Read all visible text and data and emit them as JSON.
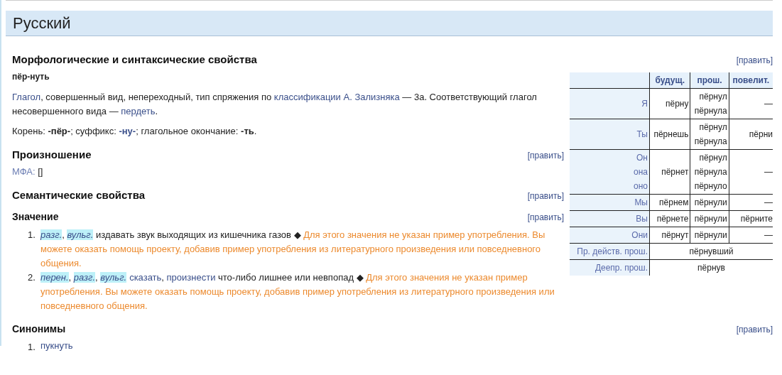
{
  "language_header": "Русский",
  "morphology": {
    "heading": "Морфологические и синтаксические свойства",
    "edit": "[править]",
    "headword": "пёр-нуть",
    "paragraphs": [
      [
        {
          "kind": "link",
          "text": "Глагол"
        },
        {
          "kind": "plain",
          "text": ", совершенный вид, непереходный, тип спряжения по "
        },
        {
          "kind": "link",
          "text": "классификации А. Зализняка"
        },
        {
          "kind": "plain",
          "text": " — 3a. Соответствующий глагол несовершенного вида — "
        },
        {
          "kind": "link",
          "text": "пердеть"
        },
        {
          "kind": "plain",
          "text": "."
        }
      ],
      [
        {
          "kind": "plain",
          "text": "Корень: "
        },
        {
          "kind": "bold",
          "text": "-пёр-"
        },
        {
          "kind": "plain",
          "text": "; суффикс: "
        },
        {
          "kind": "boldlink",
          "text": "-ну-"
        },
        {
          "kind": "plain",
          "text": "; глагольное окончание: "
        },
        {
          "kind": "bold",
          "text": "-ть"
        },
        {
          "kind": "plain",
          "text": "."
        }
      ]
    ]
  },
  "conjugation": {
    "columns": [
      "будущ.",
      "прош.",
      "повелит."
    ],
    "rows": [
      {
        "person": [
          "Я"
        ],
        "forms": [
          [
            "пёрну"
          ],
          [
            "пёрнул",
            "пёрнула"
          ],
          [
            "—"
          ]
        ]
      },
      {
        "person": [
          "Ты"
        ],
        "forms": [
          [
            "пёрнешь"
          ],
          [
            "пёрнул",
            "пёрнула"
          ],
          [
            "пёрни"
          ]
        ]
      },
      {
        "person": [
          "Он",
          "она",
          "оно"
        ],
        "forms": [
          [
            "пёрнет"
          ],
          [
            "пёрнул",
            "пёрнула",
            "пёрнуло"
          ],
          [
            "—"
          ]
        ]
      },
      {
        "person": [
          "Мы"
        ],
        "forms": [
          [
            "пёрнем"
          ],
          [
            "пёрнули"
          ],
          [
            "—"
          ]
        ]
      },
      {
        "person": [
          "Вы"
        ],
        "forms": [
          [
            "пёрнете"
          ],
          [
            "пёрнули"
          ],
          [
            "пёрните"
          ]
        ]
      },
      {
        "person": [
          "Они"
        ],
        "forms": [
          [
            "пёрнут"
          ],
          [
            "пёрнули"
          ],
          [
            "—"
          ]
        ]
      }
    ],
    "participles": [
      {
        "label": "Пр. действ. прош.",
        "value": "пёрнувший"
      },
      {
        "label": "Деепр. прош.",
        "value": "пёрнув"
      }
    ]
  },
  "pronunciation": {
    "heading": "Произношение",
    "edit": "[править]",
    "ipa_label": "МФА:",
    "ipa_value": "[]"
  },
  "semantics": {
    "heading": "Семантические свойства",
    "edit": "[править]"
  },
  "meaning": {
    "heading": "Значение",
    "edit": "[править]",
    "items": [
      {
        "number": "1.",
        "segments": [
          {
            "kind": "tag",
            "text": "разг."
          },
          {
            "kind": "plain",
            "text": ", "
          },
          {
            "kind": "tag",
            "text": "вульг."
          },
          {
            "kind": "plain",
            "text": " издавать звук выходящих из кишечника газов ◆ "
          },
          {
            "kind": "example",
            "text": "Для этого значения не указан пример употребления. Вы можете оказать помощь проекту, добавив пример употребления из литературного произведения или повседневного общения."
          }
        ]
      },
      {
        "number": "2.",
        "segments": [
          {
            "kind": "tag",
            "text": "перен."
          },
          {
            "kind": "plain",
            "text": ", "
          },
          {
            "kind": "tag",
            "text": "разг."
          },
          {
            "kind": "plain",
            "text": ", "
          },
          {
            "kind": "tag",
            "text": "вульг."
          },
          {
            "kind": "link",
            "text": "сказать"
          },
          {
            "kind": "plain",
            "text": ", "
          },
          {
            "kind": "link",
            "text": "произнести"
          },
          {
            "kind": "plain",
            "text": " что-либо лишнее или невпопад ◆ "
          },
          {
            "kind": "example",
            "text": "Для этого значения не указан пример употребления. Вы можете оказать помощь проекту, добавив пример употребления из литературного произведения или повседневного общения."
          }
        ]
      }
    ]
  },
  "synonyms": {
    "heading": "Синонимы",
    "edit": "[править]",
    "items": [
      {
        "number": "1.",
        "text": "пукнуть"
      }
    ]
  }
}
